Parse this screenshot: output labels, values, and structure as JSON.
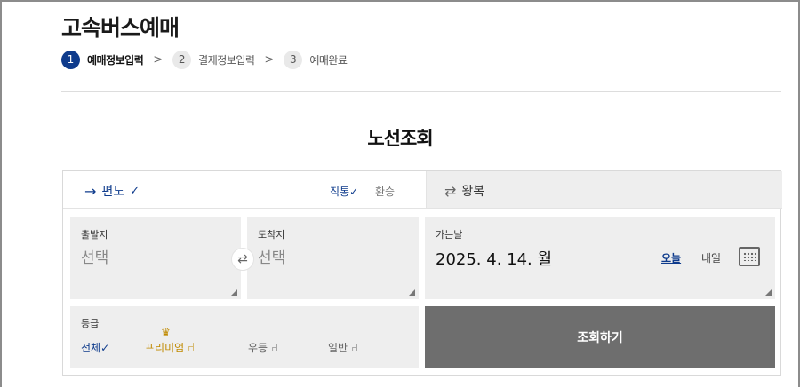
{
  "page": {
    "title": "고속버스예매"
  },
  "steps": [
    {
      "num": "1",
      "label": "예매정보입력"
    },
    {
      "num": "2",
      "label": "결제정보입력"
    },
    {
      "num": "3",
      "label": "예매완료"
    }
  ],
  "step_separator": ">",
  "section": {
    "title": "노선조회"
  },
  "trip": {
    "oneway_label": "편도",
    "oneway_arrow": "→",
    "check": "✓",
    "direct_label": "직통",
    "transfer_label": "환승",
    "round_label": "왕복",
    "round_icon": "⇄"
  },
  "departure": {
    "label": "출발지",
    "value": "선택"
  },
  "arrival": {
    "label": "도착지",
    "value": "선택"
  },
  "swap_icon": "⇄",
  "date": {
    "label": "가는날",
    "value": "2025. 4. 14. 월",
    "today": "오늘",
    "tomorrow": "내일"
  },
  "grade": {
    "label": "등급",
    "all": "전체",
    "premium": "프리미엄",
    "crown_icon": "♛",
    "excellent": "우등",
    "normal": "일반",
    "seat_icon": "⑁"
  },
  "search_button": "조회하기",
  "colors": {
    "accent": "#0e3b8c",
    "premium": "#c08a00",
    "button": "#6e6e6e",
    "box": "#eeeeee"
  }
}
